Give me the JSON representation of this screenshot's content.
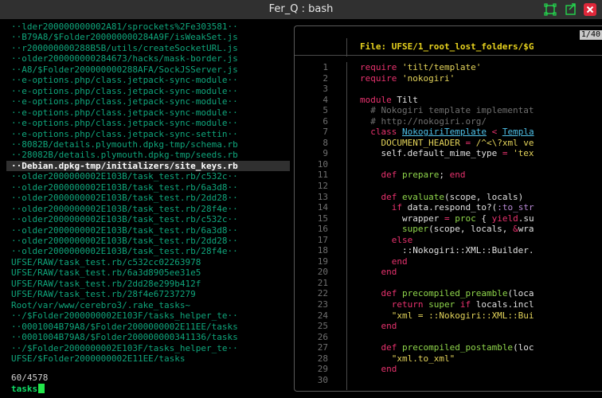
{
  "window": {
    "title": "Fer_Q : bash"
  },
  "file_list": {
    "rows": [
      "··lder200000000002A81/sprockets%2Fe303581··",
      "··B79A8/$Folder200000000284A9F/isWeakSet.js",
      "··r200000000288B5B/utils/createSocketURL.js",
      "··older200000000284673/hacks/mask-border.js",
      "··A8/$Folder200000000288AFA/SockJSServer.js",
      "··e-options.php/class.jetpack-sync-module··",
      "··e-options.php/class.jetpack-sync-module··",
      "··e-options.php/class.jetpack-sync-module··",
      "··e-options.php/class.jetpack-sync-module··",
      "··e-options.php/class.jetpack-sync-module··",
      "··e-options.php/class.jetpack-sync-settin··",
      "··8082B/details.plymouth.dpkg-tmp/schema.rb",
      "··28082B/details.plymouth.dpkg-tmp/seeds.rb",
      "··Debian.dpkg-tmp/initializers/site_keys.rb",
      "··older2000000002E103B/task_test.rb/c532c··",
      "··older2000000002E103B/task_test.rb/6a3d8··",
      "··older2000000002E103B/task_test.rb/2dd28··",
      "··older2000000002E103B/task_test.rb/28f4e··",
      "··older2000000002E103B/task_test.rb/c532c··",
      "··older2000000002E103B/task_test.rb/6a3d8··",
      "··older2000000002E103B/task_test.rb/2dd28··",
      "··older2000000002E103B/task_test.rb/28f4e··",
      "UFSE/RAW/task_test.rb/c532cc02263978",
      "UFSE/RAW/task_test.rb/6a3d8905ee31e5",
      "UFSE/RAW/task_test.rb/2dd28e299b412f",
      "UFSE/RAW/task_test.rb/28f4e67237279",
      "Root/var/www/cerebro3/.rake_tasks~",
      "··/$Folder2000000002E103F/tasks_helper_te··",
      "··0001004B79A8/$Folder2000000002E11EE/tasks",
      "··0001004B79A8/$Folder200000000341136/tasks",
      "··/$Folder2000000002E103F/tasks_helper_te··",
      "UFSE/$Folder2000000002E11EE/tasks",
      "UFSE/RAW/tasks_helper_test.rb"
    ],
    "selected_index": 13
  },
  "status": {
    "count": "60/4578"
  },
  "prompt": {
    "query": "tasks"
  },
  "preview": {
    "counter": "1/40",
    "header": "File: UFSE/1_root_lost_folders/$G",
    "lines": [
      {
        "n": "1",
        "tokens": [
          [
            "k",
            "require "
          ],
          [
            "s",
            "'tilt/template'"
          ]
        ]
      },
      {
        "n": "2",
        "tokens": [
          [
            "k",
            "require "
          ],
          [
            "s",
            "'nokogiri'"
          ]
        ]
      },
      {
        "n": "3",
        "tokens": []
      },
      {
        "n": "4",
        "tokens": [
          [
            "k",
            "module "
          ],
          [
            "t",
            "Tilt"
          ]
        ]
      },
      {
        "n": "5",
        "tokens": [
          [
            "c",
            "  # Nokogiri template implementat"
          ]
        ]
      },
      {
        "n": "6",
        "tokens": [
          [
            "c",
            "  # http://nokogiri.org/"
          ]
        ]
      },
      {
        "n": "7",
        "tokens": [
          [
            "k",
            "  class "
          ],
          [
            "cn",
            "NokogiriTemplate"
          ],
          [
            "k",
            " < "
          ],
          [
            "cn",
            "Templa"
          ]
        ]
      },
      {
        "n": "8",
        "tokens": [
          [
            "y",
            "    DOCUMENT_HEADER "
          ],
          [
            "k",
            "= "
          ],
          [
            "s",
            "/^<\\?xml ve"
          ]
        ]
      },
      {
        "n": "9",
        "tokens": [
          [
            "t",
            "    self.default_mime_type "
          ],
          [
            "k",
            "= "
          ],
          [
            "s",
            "'tex"
          ]
        ]
      },
      {
        "n": "10",
        "tokens": []
      },
      {
        "n": "11",
        "tokens": [
          [
            "k",
            "    def "
          ],
          [
            "f",
            "prepare"
          ],
          [
            "t",
            "; "
          ],
          [
            "k",
            "end"
          ]
        ]
      },
      {
        "n": "12",
        "tokens": []
      },
      {
        "n": "13",
        "tokens": [
          [
            "k",
            "    def "
          ],
          [
            "f",
            "evaluate"
          ],
          [
            "t",
            "(scope, locals)"
          ]
        ]
      },
      {
        "n": "14",
        "tokens": [
          [
            "k",
            "      if "
          ],
          [
            "t",
            "data.respond_to?("
          ],
          [
            "sym",
            ":to_str"
          ]
        ]
      },
      {
        "n": "15",
        "tokens": [
          [
            "t",
            "        wrapper "
          ],
          [
            "k",
            "= "
          ],
          [
            "f",
            "proc "
          ],
          [
            "t",
            "{ "
          ],
          [
            "k",
            "yield"
          ],
          [
            "t",
            ".su"
          ]
        ]
      },
      {
        "n": "16",
        "tokens": [
          [
            "f",
            "        super"
          ],
          [
            "t",
            "(scope, locals, "
          ],
          [
            "k",
            "&"
          ],
          [
            "t",
            "wra"
          ]
        ]
      },
      {
        "n": "17",
        "tokens": [
          [
            "k",
            "      else"
          ]
        ]
      },
      {
        "n": "18",
        "tokens": [
          [
            "t",
            "        ::Nokogiri::XML::Builder."
          ]
        ]
      },
      {
        "n": "19",
        "tokens": [
          [
            "k",
            "      end"
          ]
        ]
      },
      {
        "n": "20",
        "tokens": [
          [
            "k",
            "    end"
          ]
        ]
      },
      {
        "n": "21",
        "tokens": []
      },
      {
        "n": "22",
        "tokens": [
          [
            "k",
            "    def "
          ],
          [
            "f",
            "precompiled_preamble"
          ],
          [
            "t",
            "(loca"
          ]
        ]
      },
      {
        "n": "23",
        "tokens": [
          [
            "k",
            "      return "
          ],
          [
            "f",
            "super "
          ],
          [
            "k",
            "if "
          ],
          [
            "t",
            "locals.incl"
          ]
        ]
      },
      {
        "n": "24",
        "tokens": [
          [
            "s",
            "      \"xml = ::Nokogiri::XML::Bui"
          ]
        ]
      },
      {
        "n": "25",
        "tokens": [
          [
            "k",
            "    end"
          ]
        ]
      },
      {
        "n": "26",
        "tokens": []
      },
      {
        "n": "27",
        "tokens": [
          [
            "k",
            "    def "
          ],
          [
            "f",
            "precompiled_postamble"
          ],
          [
            "t",
            "(loc"
          ]
        ]
      },
      {
        "n": "28",
        "tokens": [
          [
            "s",
            "      \"xml.to_xml\""
          ]
        ]
      },
      {
        "n": "29",
        "tokens": [
          [
            "k",
            "    end"
          ]
        ]
      },
      {
        "n": "30",
        "tokens": []
      }
    ]
  },
  "colors": {
    "match": "#0fa67c",
    "prompt": "#0fdd66",
    "cursor": "#23e74b",
    "header": "#e8d31e",
    "keyword": "#e8326e",
    "string": "#e3d35a",
    "function": "#8fd54b",
    "constant": "#4ec0e8"
  },
  "icons": {
    "maximize": "maximize-icon",
    "pin": "pin-icon",
    "close": "close-icon"
  }
}
